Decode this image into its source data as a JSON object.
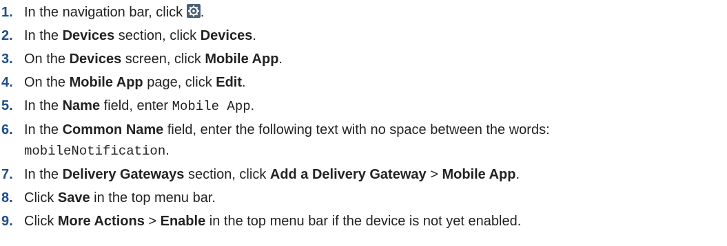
{
  "steps": [
    {
      "num": "1.",
      "parts": [
        "In the navigation bar, click ",
        "."
      ]
    },
    {
      "num": "2.",
      "parts": [
        "In the ",
        "Devices",
        " section, click ",
        "Devices",
        "."
      ]
    },
    {
      "num": "3.",
      "parts": [
        "On the ",
        "Devices",
        " screen, click ",
        "Mobile App",
        "."
      ]
    },
    {
      "num": "4.",
      "parts": [
        "On the ",
        "Mobile App",
        " page, click ",
        "Edit",
        "."
      ]
    },
    {
      "num": "5.",
      "parts": [
        "In the ",
        "Name",
        " field, enter ",
        "Mobile App",
        "."
      ]
    },
    {
      "num": "6.",
      "parts": [
        "In the ",
        "Common Name",
        " field, enter the following text with no space between the words:",
        "mobileNotification",
        "."
      ]
    },
    {
      "num": "7.",
      "parts": [
        "In the ",
        "Delivery Gateways",
        " section, click ",
        "Add a Delivery Gateway",
        " > ",
        "Mobile App",
        "."
      ]
    },
    {
      "num": "8.",
      "parts": [
        "Click ",
        "Save",
        " in the top menu bar."
      ]
    },
    {
      "num": "9.",
      "parts": [
        "Click ",
        "More Actions",
        " > ",
        "Enable",
        " in the top menu bar if the device is not yet enabled."
      ]
    }
  ],
  "icons": {
    "settings": "gear-icon"
  },
  "colors": {
    "step_number": "#1f4e8c",
    "text": "#222222",
    "icon_bg": "#4a5f74"
  }
}
